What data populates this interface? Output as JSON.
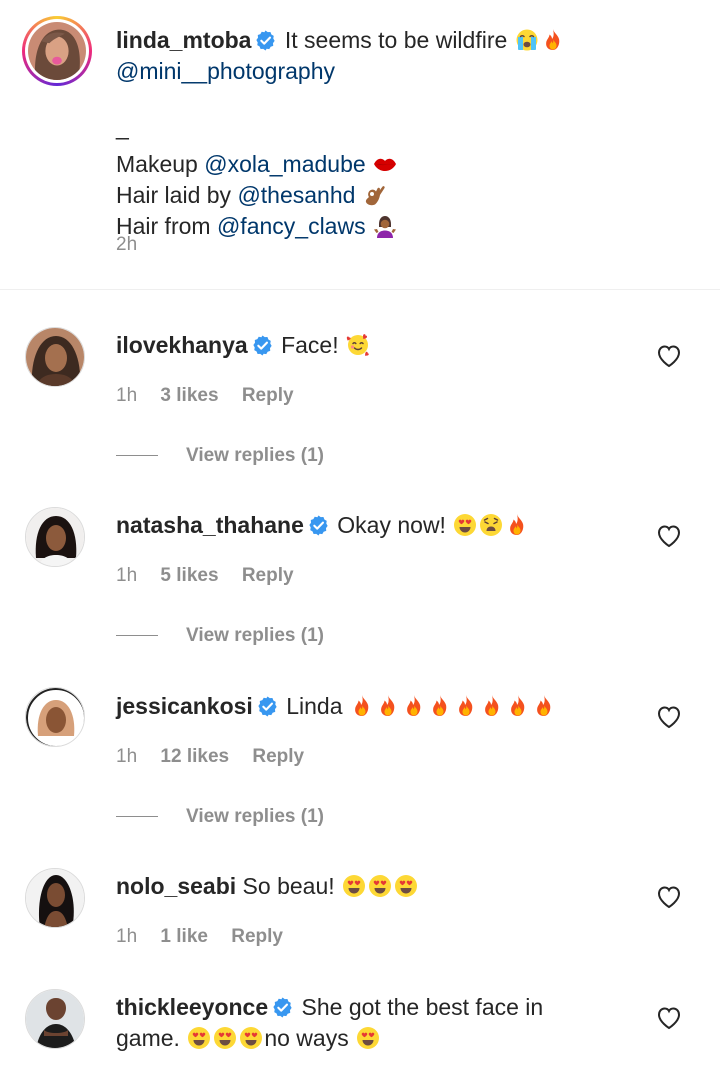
{
  "caption": {
    "username": "linda_mtoba",
    "text": "It seems to be wildfire",
    "mention_photo": "@mini__photography",
    "dash": "_",
    "makeup_label": "Makeup",
    "makeup_mention": "@xola_madube",
    "hair_laid_label": "Hair laid by",
    "hair_laid_mention": "@thesanhd",
    "hair_from_label": "Hair from",
    "hair_from_mention": "@fancy_claws",
    "time": "2h"
  },
  "comments": [
    {
      "username": "ilovekhanya",
      "verified": true,
      "text": "Face!",
      "emojis": [
        "smiling-hearts"
      ],
      "time": "1h",
      "likes": "3 likes",
      "reply": "Reply",
      "view_replies": "View replies (1)"
    },
    {
      "username": "natasha_thahane",
      "verified": true,
      "text": "Okay now!",
      "emojis": [
        "heart-eyes",
        "weary",
        "fire"
      ],
      "time": "1h",
      "likes": "5 likes",
      "reply": "Reply",
      "view_replies": "View replies (1)"
    },
    {
      "username": "jessicankosi",
      "verified": true,
      "text": "Linda",
      "emojis": [
        "fire",
        "fire",
        "fire",
        "fire",
        "fire",
        "fire",
        "fire",
        "fire"
      ],
      "time": "1h",
      "likes": "12 likes",
      "reply": "Reply",
      "view_replies": "View replies (1)"
    },
    {
      "username": "nolo_seabi",
      "verified": false,
      "text": "So beau!",
      "emojis": [
        "heart-eyes",
        "heart-eyes",
        "heart-eyes"
      ],
      "time": "1h",
      "likes": "1 like",
      "reply": "Reply"
    },
    {
      "username": "thickleeyonce",
      "verified": true,
      "text": "She got the best face in",
      "text2_a": "game.",
      "text2_b": "no ways"
    }
  ],
  "colors": {
    "verified": "#3897f0",
    "mention": "#00376b",
    "secondary": "#8e8e8e"
  }
}
